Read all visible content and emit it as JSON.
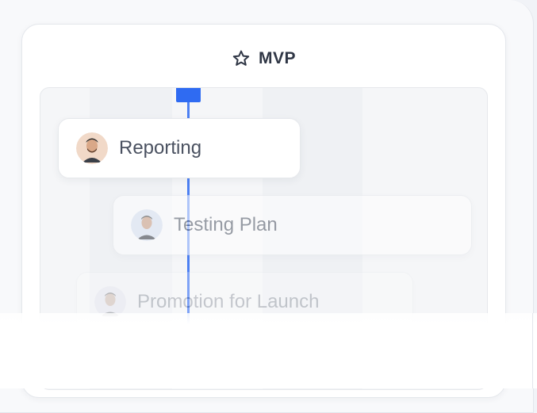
{
  "project": {
    "title": "MVP",
    "icon": "star-icon"
  },
  "tasks": [
    {
      "label": "Reporting",
      "avatar": "avatar-man-beard"
    },
    {
      "label": "Testing Plan",
      "avatar": "avatar-man-gray"
    },
    {
      "label": "Promotion for Launch",
      "avatar": "avatar-man-dark"
    }
  ],
  "colors": {
    "accent": "#2f6bf2",
    "text": "#2f3645",
    "card": "#ffffff",
    "background": "#f1f3f7"
  }
}
